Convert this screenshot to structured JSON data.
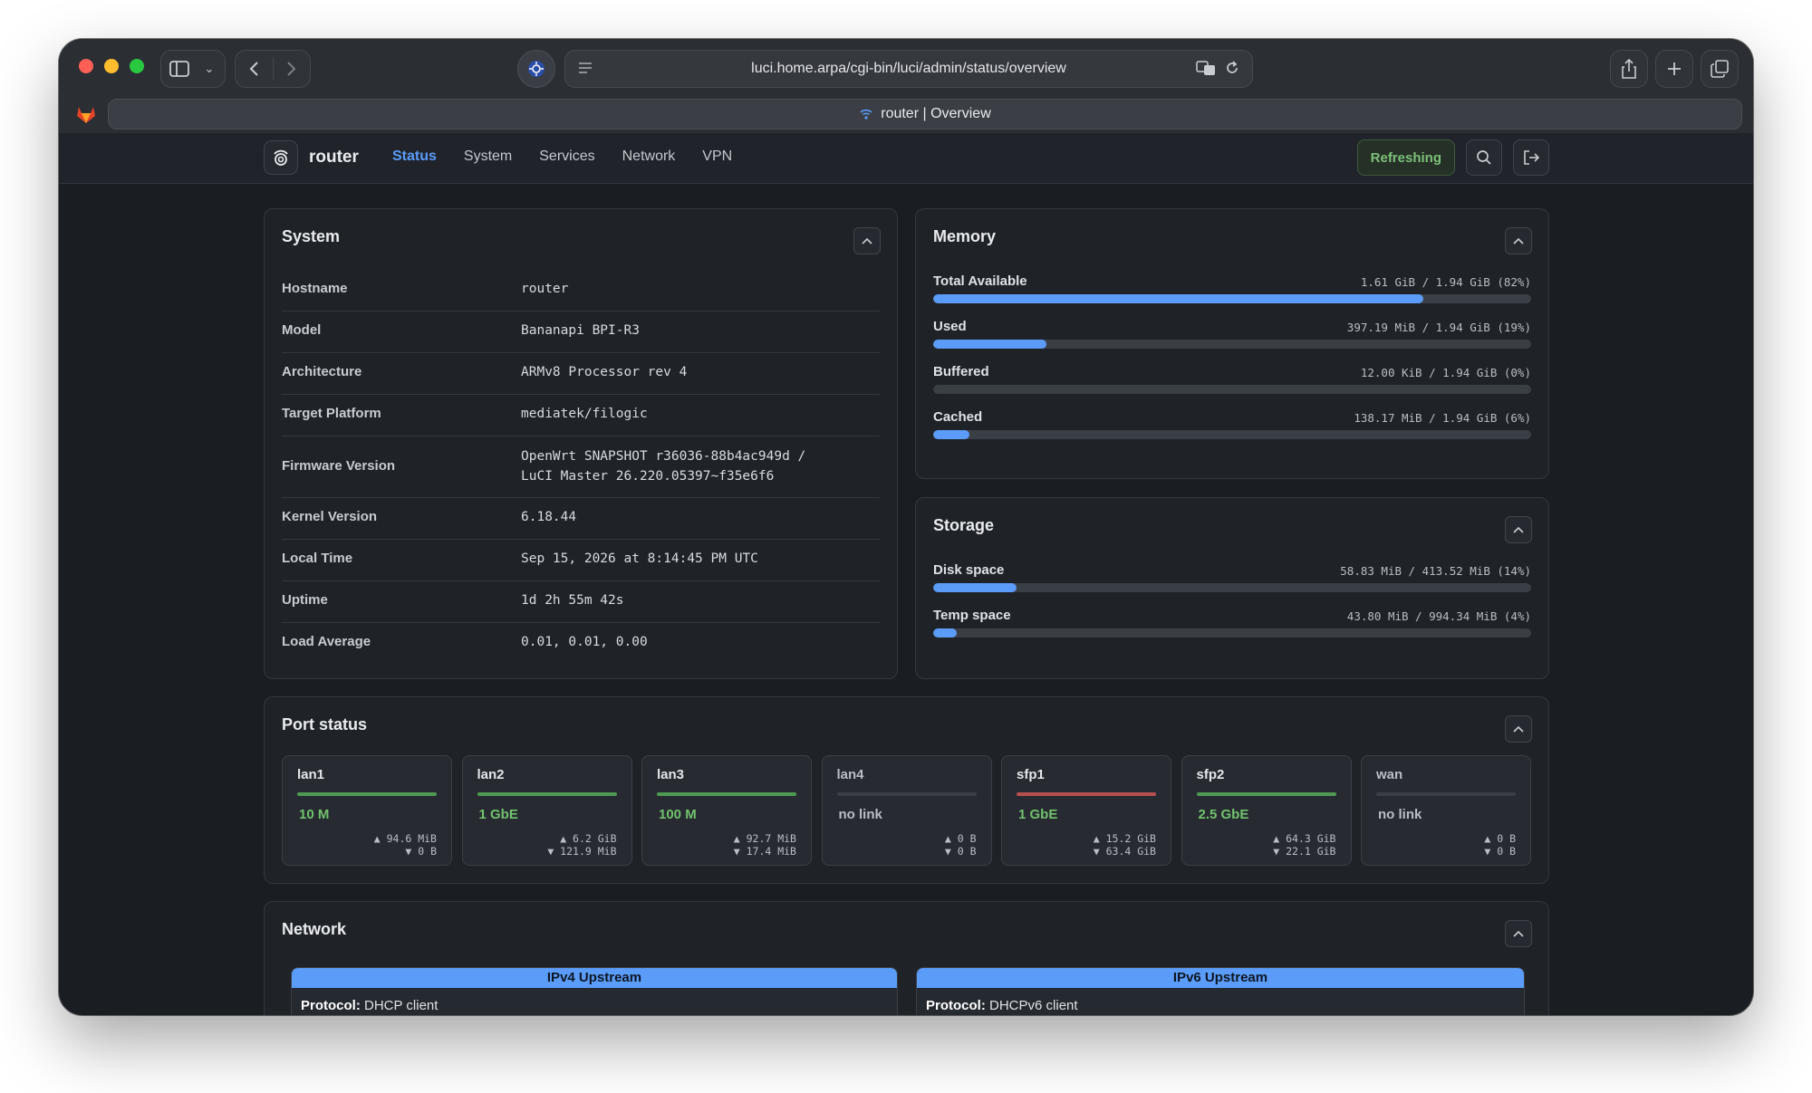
{
  "browser": {
    "url": "luci.home.arpa/cgi-bin/luci/admin/status/overview",
    "tab_title": "router | Overview"
  },
  "header": {
    "brand": "router",
    "nav": [
      "Status",
      "System",
      "Services",
      "Network",
      "VPN"
    ],
    "active_nav": "Status",
    "refresh_label": "Refreshing"
  },
  "system": {
    "title": "System",
    "rows": [
      {
        "key": "Hostname",
        "value": "router"
      },
      {
        "key": "Model",
        "value": "Bananapi BPI-R3"
      },
      {
        "key": "Architecture",
        "value": "ARMv8 Processor rev 4"
      },
      {
        "key": "Target Platform",
        "value": "mediatek/filogic"
      },
      {
        "key": "Firmware Version",
        "value": "OpenWrt SNAPSHOT r36036-88b4ac949d /",
        "value2": "LuCI Master 26.220.05397~f35e6f6"
      },
      {
        "key": "Kernel Version",
        "value": "6.18.44"
      },
      {
        "key": "Local Time",
        "value": "Sep 15, 2026 at 8:14:45 PM UTC"
      },
      {
        "key": "Uptime",
        "value": "1d 2h 55m 42s"
      },
      {
        "key": "Load Average",
        "value": "0.01, 0.01, 0.00"
      }
    ]
  },
  "memory": {
    "title": "Memory",
    "meters": [
      {
        "label": "Total Available",
        "value": "1.61 GiB / 1.94 GiB (82%)",
        "percent": 82
      },
      {
        "label": "Used",
        "value": "397.19 MiB / 1.94 GiB (19%)",
        "percent": 19
      },
      {
        "label": "Buffered",
        "value": "12.00 KiB / 1.94 GiB (0%)",
        "percent": 0
      },
      {
        "label": "Cached",
        "value": "138.17 MiB / 1.94 GiB (6%)",
        "percent": 6
      }
    ]
  },
  "storage": {
    "title": "Storage",
    "meters": [
      {
        "label": "Disk space",
        "value": "58.83 MiB / 413.52 MiB (14%)",
        "percent": 14
      },
      {
        "label": "Temp space",
        "value": "43.80 MiB / 994.34 MiB (4%)",
        "percent": 4
      }
    ]
  },
  "ports": {
    "title": "Port status",
    "items": [
      {
        "name": "lan1",
        "speed": "10 M",
        "up": "▲ 94.6 MiB",
        "down": "▼ 0 B",
        "link": "green"
      },
      {
        "name": "lan2",
        "speed": "1 GbE",
        "up": "▲ 6.2 GiB",
        "down": "▼ 121.9 MiB",
        "link": "green"
      },
      {
        "name": "lan3",
        "speed": "100 M",
        "up": "▲ 92.7 MiB",
        "down": "▼ 17.4 MiB",
        "link": "green"
      },
      {
        "name": "lan4",
        "speed": "no link",
        "up": "▲ 0 B",
        "down": "▼ 0 B",
        "link": "none"
      },
      {
        "name": "sfp1",
        "speed": "1 GbE",
        "up": "▲ 15.2 GiB",
        "down": "▼ 63.4 GiB",
        "link": "red"
      },
      {
        "name": "sfp2",
        "speed": "2.5 GbE",
        "up": "▲ 64.3 GiB",
        "down": "▼ 22.1 GiB",
        "link": "green"
      },
      {
        "name": "wan",
        "speed": "no link",
        "up": "▲ 0 B",
        "down": "▼ 0 B",
        "link": "none"
      }
    ]
  },
  "network": {
    "title": "Network",
    "ipv4": {
      "head": "IPv4 Upstream",
      "proto_label": "Protocol:",
      "proto": "DHCP client"
    },
    "ipv6": {
      "head": "IPv6 Upstream",
      "proto_label": "Protocol:",
      "proto": "DHCPv6 client"
    }
  },
  "colors": {
    "accent": "#5a9cf8",
    "link_green": "#4f9a52",
    "link_red": "#b64f4f",
    "speed_green": "#72c26e"
  }
}
